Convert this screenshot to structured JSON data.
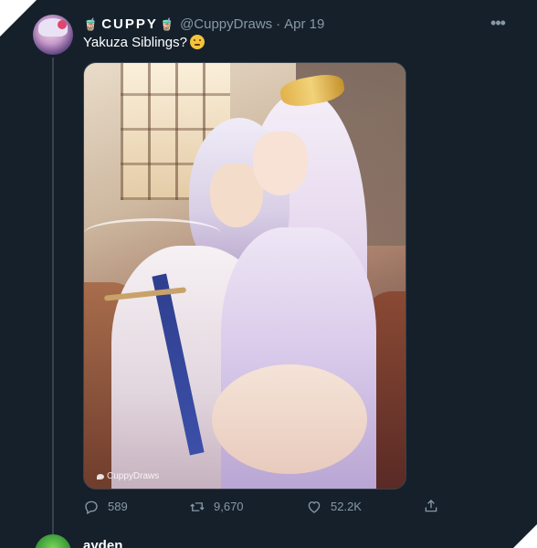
{
  "tweet": {
    "display_name": "CUPPY",
    "handle": "@CuppyDraws",
    "separator": "·",
    "date": "Apr 19",
    "text": "Yakuza Siblings?",
    "more_icon": "more-horizontal-icon",
    "media": {
      "watermark": "CuppyDraws"
    },
    "actions": {
      "reply_count": "589",
      "retweet_count": "9,670",
      "like_count": "52.2K"
    }
  },
  "next_tweet": {
    "display_name": "ayden"
  },
  "colors": {
    "background": "#15202b",
    "secondary_text": "#8899a6",
    "divider": "#38444d"
  }
}
